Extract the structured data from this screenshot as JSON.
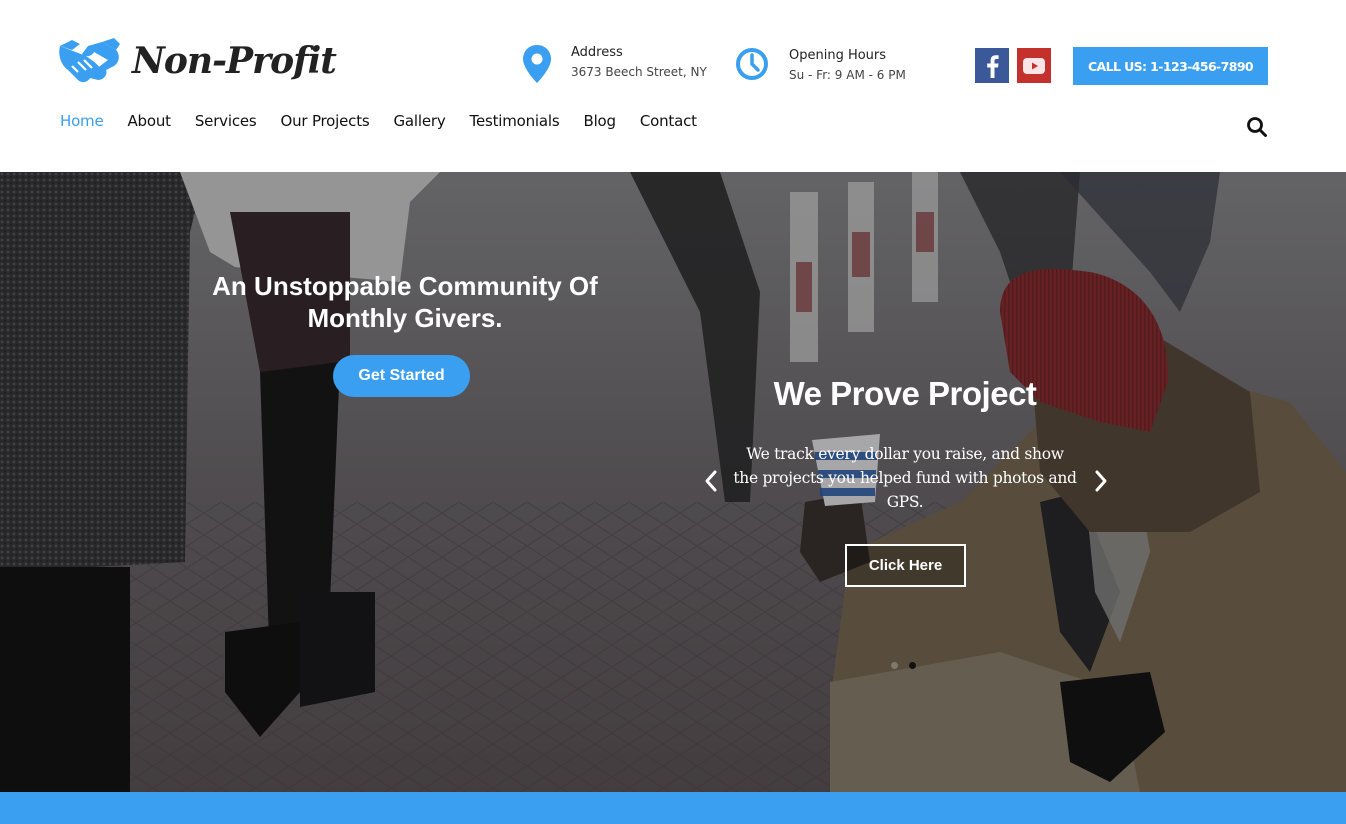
{
  "brand": {
    "name": "Non-Profit",
    "logo_icon": "handshake-icon",
    "accent_color": "#3a9ff0"
  },
  "header": {
    "address": {
      "icon": "map-pin-icon",
      "title": "Address",
      "value": "3673 Beech Street, NY"
    },
    "hours": {
      "icon": "clock-icon",
      "title": "Opening Hours",
      "value": "Su - Fr: 9 AM - 6 PM"
    },
    "social": [
      {
        "name": "facebook",
        "icon": "facebook-icon",
        "color": "#3b5998"
      },
      {
        "name": "youtube",
        "icon": "youtube-icon",
        "color": "#c4302b"
      }
    ],
    "call_button": "CALL US: 1-123-456-7890"
  },
  "nav": {
    "items": [
      {
        "label": "Home",
        "active": true
      },
      {
        "label": "About",
        "active": false
      },
      {
        "label": "Services",
        "active": false
      },
      {
        "label": "Our Projects",
        "active": false
      },
      {
        "label": "Gallery",
        "active": false
      },
      {
        "label": "Testimonials",
        "active": false
      },
      {
        "label": "Blog",
        "active": false
      },
      {
        "label": "Contact",
        "active": false
      }
    ],
    "search_icon": "search-icon"
  },
  "hero": {
    "left": {
      "title": "An Unstoppable Community Of Monthly Givers.",
      "button": "Get Started"
    },
    "slide": {
      "title": "We Prove Project",
      "text": "We track every dollar you raise, and show the projects you helped fund with photos and GPS.",
      "button": "Click Here",
      "prev_icon": "chevron-left-icon",
      "next_icon": "chevron-right-icon",
      "dots": [
        {
          "active": false
        },
        {
          "active": true
        }
      ]
    }
  }
}
